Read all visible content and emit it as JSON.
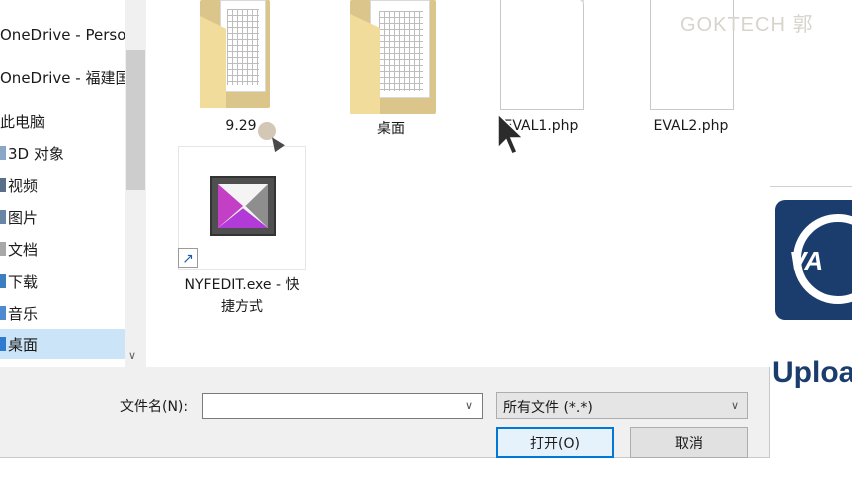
{
  "nav": {
    "items": [
      {
        "label": "OneDrive - Perso"
      },
      {
        "label": "OneDrive - 福建国"
      },
      {
        "label": "此电脑"
      },
      {
        "label": "3D 对象"
      },
      {
        "label": "视频"
      },
      {
        "label": "图片"
      },
      {
        "label": "文档"
      },
      {
        "label": "下载"
      },
      {
        "label": "音乐"
      },
      {
        "label": "桌面"
      }
    ],
    "selected": "桌面"
  },
  "files": [
    {
      "name": "9.29",
      "icon": "folder-icon"
    },
    {
      "name": "桌面",
      "icon": "folder-icon"
    },
    {
      "name": "EVAL1.php",
      "icon": "php-file-icon"
    },
    {
      "name": "EVAL2.php",
      "icon": "php-file-icon"
    },
    {
      "name_line1": "NYFEDIT.exe - 快",
      "name_line2": "捷方式",
      "icon": "exe-shortcut-icon"
    }
  ],
  "watermark": "GOKTECH  郭",
  "bottom": {
    "filename_label": "文件名(N):",
    "filename_value": "",
    "filter_value": "所有文件 (*.*)",
    "open_button": "打开(O)",
    "cancel_button": "取消"
  },
  "background_page": {
    "logo_text": "VA",
    "heading": "Uploa"
  },
  "colors": {
    "selection": "#cce4f7",
    "primary_border": "#0078d7",
    "brand_navy": "#1b3d6e"
  }
}
